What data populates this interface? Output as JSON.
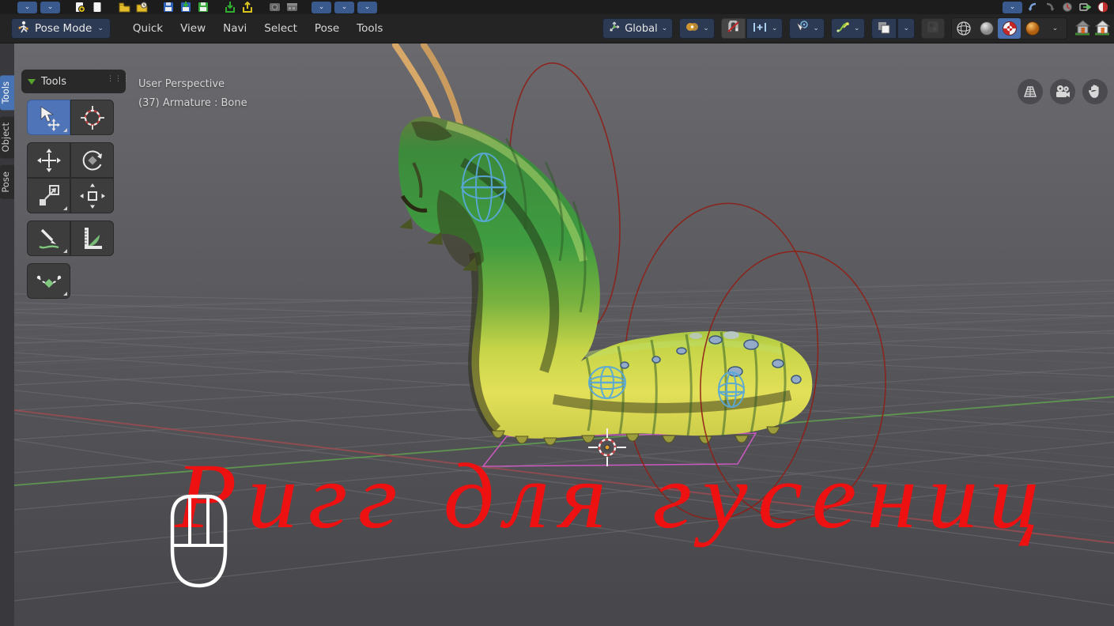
{
  "top_toolbar": {
    "left_icons": [
      "dropdown",
      "dropdown",
      "new-file",
      "blank-file",
      "open-folder",
      "recent-folder",
      "save",
      "save-as",
      "save-copy",
      "import",
      "export",
      "render-image",
      "render-animation",
      "dropdown",
      "dropdown",
      "dropdown"
    ],
    "right_icons": [
      "dropdown",
      "undo",
      "redo",
      "recover-session",
      "link-append",
      "material-sphere"
    ]
  },
  "header": {
    "mode": {
      "label": "Pose Mode",
      "icon": "pose-figure-icon"
    },
    "menus": [
      {
        "label": "Quick"
      },
      {
        "label": "View"
      },
      {
        "label": "Navi"
      },
      {
        "label": "Select"
      },
      {
        "label": "Pose"
      },
      {
        "label": "Tools"
      }
    ],
    "transform_orientation": {
      "label": "Global",
      "icon": "orientation-axes-icon"
    },
    "pivot": {
      "icon": "pivot-point-icon"
    },
    "snap": {
      "enabled": false,
      "magnet_icon": "magnet-icon",
      "target_icon": "snap-increment-icon"
    },
    "proportional": {
      "icon": "proportional-editing-icon"
    },
    "falloff": {
      "icon": "falloff-curve-icon"
    },
    "overlays": {
      "icon": "overlays-icon"
    },
    "xray": {
      "icon": "xray-icon",
      "enabled": false
    },
    "shading": {
      "modes": [
        "wireframe",
        "solid",
        "material-preview",
        "rendered"
      ],
      "active": "material-preview"
    },
    "extra_icons": [
      "home-icon",
      "home-icon"
    ]
  },
  "side_tabs": {
    "items": [
      {
        "label": "Tools",
        "active": true
      },
      {
        "label": "Object",
        "active": false
      },
      {
        "label": "Pose",
        "active": false
      }
    ]
  },
  "tools_panel": {
    "title": "Tools",
    "tools": [
      "select-box",
      "cursor",
      "move",
      "rotate",
      "scale",
      "transform",
      "annotate",
      "measure",
      "pose-breakdowner"
    ]
  },
  "viewport": {
    "info_line1": "User Perspective",
    "info_line2": "(37) Armature : Bone",
    "nav_buttons": [
      "zoom-grid",
      "camera-view",
      "pan-hand"
    ],
    "scene_objects": [
      "caterpillar-mesh",
      "armature-bone-circle",
      "armature-bone-circle",
      "armature-bone-circle",
      "bone-sphere-gizmo",
      "bone-sphere-gizmo",
      "bone-sphere-gizmo",
      "root-bone-plane",
      "3d-cursor"
    ]
  },
  "caption": {
    "text": "Ригг для гусениц",
    "color": "#ed1111"
  },
  "icons": {
    "chevron": "⌄",
    "grip_dots": "⋮⋮⋮"
  },
  "colors": {
    "accent_blue": "#4772b3",
    "header_bg": "#242424",
    "viewport_bg": "#56565a",
    "grid_line": "#717174",
    "axis_green": "#61a14f",
    "axis_red": "#a34b50",
    "bone_circle_red": "#8e1f17",
    "bone_gizmo_blue": "#59a8d8",
    "root_plane_magenta": "#e05ad2",
    "caption_red": "#ed1111"
  }
}
